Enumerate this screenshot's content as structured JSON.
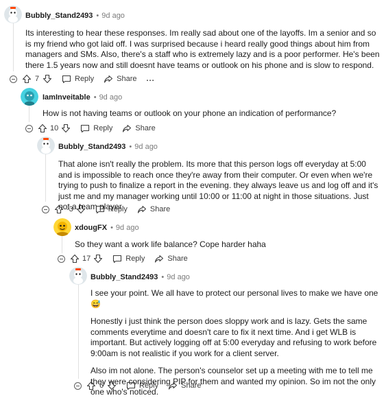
{
  "comments": [
    {
      "author": "Bubbly_Stand2493",
      "time": "9d ago",
      "paragraphs": [
        "Its interesting to hear these responses. Im really sad about one of the layoffs. Im a senior and so is my friend who got laid off. I was surprised because i heard really good things about him from managers and SMs. Also, there's a staff who is extremely lazy and is a poor performer. He's been there 1.5 years now and still doesnt have teams or outlook on his phone and is slow to respond."
      ],
      "score": "7",
      "reply_label": "Reply",
      "share_label": "Share",
      "more_label": "..."
    },
    {
      "author": "IamInveitable",
      "time": "9d ago",
      "paragraphs": [
        "How is not having teams or outlook on your phone an indication of performance?"
      ],
      "score": "10",
      "reply_label": "Reply",
      "share_label": "Share"
    },
    {
      "author": "Bubbly_Stand2493",
      "time": "9d ago",
      "paragraphs": [
        "That alone isn't really the problem. Its more that this person logs off everyday at 5:00 and is impossible to reach once they're away from their computer. Or even when we're trying to push to finalize a report in the evening. they always leave us and log off and it's just me and my manager working until 10:00 or 11:00 at night in those situations. Just not a team player"
      ],
      "score": "-3",
      "reply_label": "Reply",
      "share_label": "Share"
    },
    {
      "author": "xdougFX",
      "time": "9d ago",
      "paragraphs": [
        "So they want a work life balance? Cope harder haha"
      ],
      "score": "17",
      "reply_label": "Reply",
      "share_label": "Share"
    },
    {
      "author": "Bubbly_Stand2493",
      "time": "9d ago",
      "paragraphs": [
        "I see your point. We all have to protect our personal lives to make we have one",
        "Honestly i just think the person does sloppy work and is lazy. Gets the same comments everytime and doesn't care to fix it next time. And i get WLB is important. But actively logging off at 5:00 everyday and refusing to work before 9:00am is not realistic if you work for a client server.",
        "Also im not alone. The person's counselor set up a meeting with me to tell me they were considering PIP for them and wanted my opinion. So im not the only one who's noticed."
      ],
      "emoji": "😅",
      "score": "6",
      "reply_label": "Reply",
      "share_label": "Share"
    }
  ],
  "colors": {
    "accent": "#0079d3",
    "muted": "#7c7c7c",
    "thread_line": "#e0e0e0"
  }
}
